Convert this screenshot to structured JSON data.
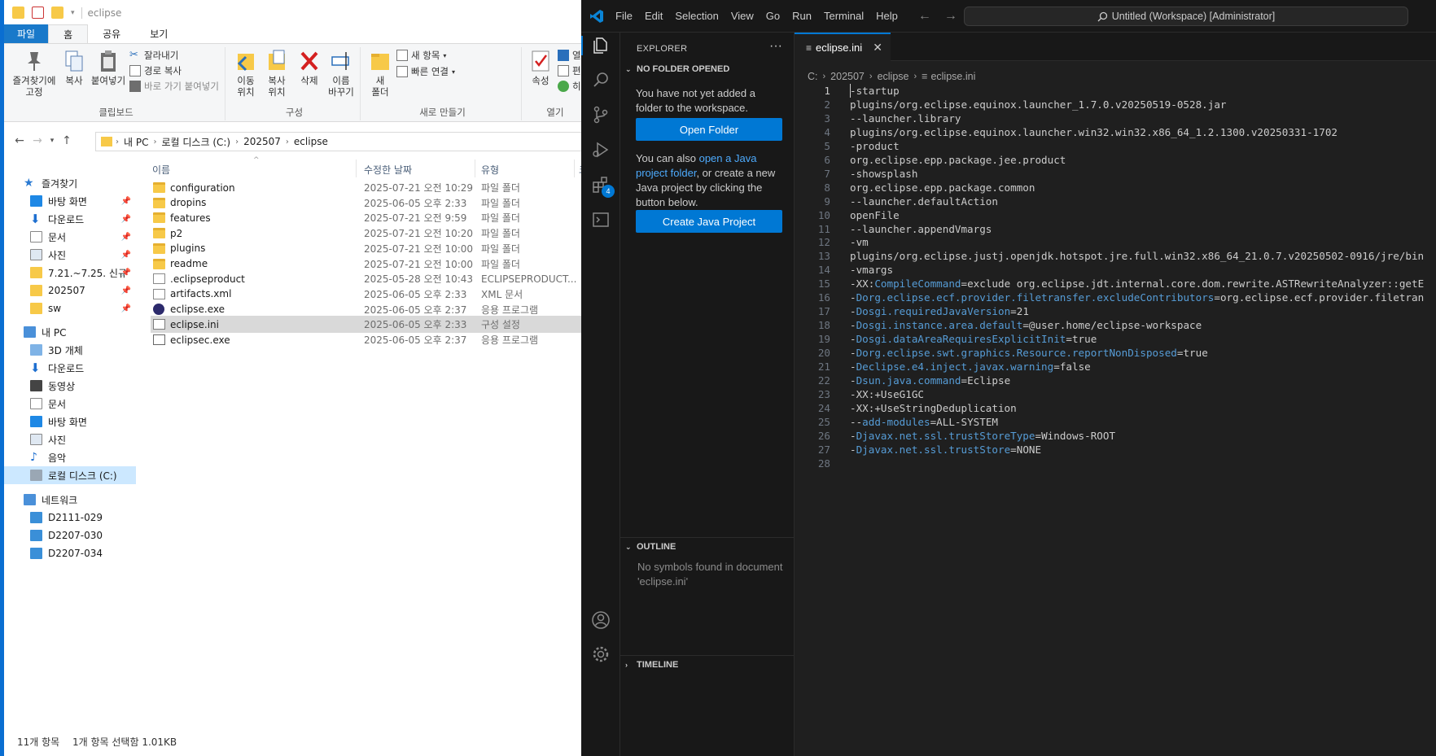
{
  "explorer": {
    "title": "eclipse",
    "tabs": [
      "파일",
      "홈",
      "공유",
      "보기"
    ],
    "ribbon": {
      "clipboard": {
        "pin": "즐겨찾기에\n고정",
        "copy": "복사",
        "paste": "붙여넣기",
        "cut": "잘라내기",
        "copy_path": "경로 복사",
        "paste_shortcut": "바로 가기 붙여넣기",
        "label": "클립보드"
      },
      "organize": {
        "move_to": "이동\n위치",
        "copy_to": "복사\n위치",
        "delete": "삭제",
        "rename": "이름\n바꾸기",
        "label": "구성"
      },
      "new": {
        "new_folder": "새\n폴더",
        "new_item": "새 항목",
        "easy_access": "빠른 연결",
        "label": "새로 만들기"
      },
      "open": {
        "properties": "속성",
        "open_short": "열",
        "edit_short": "편",
        "history_short": "히",
        "label": "열기"
      }
    },
    "address": [
      "내 PC",
      "로컬 디스크 (C:)",
      "202507",
      "eclipse"
    ],
    "nav": {
      "quick_access": "즐겨찾기",
      "quick_items": [
        "바탕 화면",
        "다운로드",
        "문서",
        "사진",
        "7.21.~7.25. 신규",
        "202507",
        "sw"
      ],
      "this_pc": "내 PC",
      "pc_items": [
        "3D 개체",
        "다운로드",
        "동영상",
        "문서",
        "바탕 화면",
        "사진",
        "음악",
        "로컬 디스크 (C:)"
      ],
      "network": "네트워크",
      "network_items": [
        "D2111-029",
        "D2207-030",
        "D2207-034"
      ]
    },
    "columns": [
      "이름",
      "수정한 날짜",
      "유형",
      "크"
    ],
    "files": [
      {
        "name": "configuration",
        "date": "2025-07-21 오전 10:29",
        "type": "파일 폴더",
        "icon": "folder"
      },
      {
        "name": "dropins",
        "date": "2025-06-05 오후 2:33",
        "type": "파일 폴더",
        "icon": "folder"
      },
      {
        "name": "features",
        "date": "2025-07-21 오전 9:59",
        "type": "파일 폴더",
        "icon": "folder"
      },
      {
        "name": "p2",
        "date": "2025-07-21 오전 10:20",
        "type": "파일 폴더",
        "icon": "folder"
      },
      {
        "name": "plugins",
        "date": "2025-07-21 오전 10:00",
        "type": "파일 폴더",
        "icon": "folder"
      },
      {
        "name": "readme",
        "date": "2025-07-21 오전 10:00",
        "type": "파일 폴더",
        "icon": "folder"
      },
      {
        "name": ".eclipseproduct",
        "date": "2025-05-28 오전 10:43",
        "type": "ECLIPSEPRODUCT...",
        "icon": "doc"
      },
      {
        "name": "artifacts.xml",
        "date": "2025-06-05 오후 2:33",
        "type": "XML 문서",
        "icon": "doc"
      },
      {
        "name": "eclipse.exe",
        "date": "2025-06-05 오후 2:37",
        "type": "응용 프로그램",
        "icon": "exe"
      },
      {
        "name": "eclipse.ini",
        "date": "2025-06-05 오후 2:33",
        "type": "구성 설정",
        "icon": "ini"
      },
      {
        "name": "eclipsec.exe",
        "date": "2025-06-05 오후 2:37",
        "type": "응용 프로그램",
        "icon": "exe2"
      }
    ],
    "status_count": "11개 항목",
    "status_selected": "1개 항목 선택함 1.01KB"
  },
  "vscode": {
    "menu": [
      "File",
      "Edit",
      "Selection",
      "View",
      "Go",
      "Run",
      "Terminal",
      "Help"
    ],
    "command_center": "Untitled (Workspace) [Administrator]",
    "explorer_title": "EXPLORER",
    "no_folder": "NO FOLDER OPENED",
    "no_folder_msg": "You have not yet added a folder to the workspace.",
    "open_folder_btn": "Open Folder",
    "java_msg_pre": "You can also ",
    "java_msg_link": "open a Java project folder",
    "java_msg_post": ", or create a new Java project by clicking the button below.",
    "create_java_btn": "Create Java Project",
    "outline": "OUTLINE",
    "outline_msg": "No symbols found in document 'eclipse.ini'",
    "timeline": "TIMELINE",
    "extensions_badge": "4",
    "tab_name": "eclipse.ini",
    "breadcrumb": [
      "C:",
      "202507",
      "eclipse",
      "eclipse.ini"
    ],
    "lines": [
      {
        "n": "1",
        "k": "",
        "v": "-startup"
      },
      {
        "n": "2",
        "k": "",
        "v": "plugins/org.eclipse.equinox.launcher_1.7.0.v20250519-0528.jar"
      },
      {
        "n": "3",
        "k": "",
        "v": "--launcher.library"
      },
      {
        "n": "4",
        "k": "",
        "v": "plugins/org.eclipse.equinox.launcher.win32.win32.x86_64_1.2.1300.v20250331-1702"
      },
      {
        "n": "5",
        "k": "",
        "v": "-product"
      },
      {
        "n": "6",
        "k": "",
        "v": "org.eclipse.epp.package.jee.product"
      },
      {
        "n": "7",
        "k": "",
        "v": "-showsplash"
      },
      {
        "n": "8",
        "k": "",
        "v": "org.eclipse.epp.package.common"
      },
      {
        "n": "9",
        "k": "",
        "v": "--launcher.defaultAction"
      },
      {
        "n": "10",
        "k": "",
        "v": "openFile"
      },
      {
        "n": "11",
        "k": "",
        "v": "--launcher.appendVmargs"
      },
      {
        "n": "12",
        "k": "",
        "v": "-vm"
      },
      {
        "n": "13",
        "k": "",
        "v": "plugins/org.eclipse.justj.openjdk.hotspot.jre.full.win32.x86_64_21.0.7.v20250502-0916/jre/bin"
      },
      {
        "n": "14",
        "k": "",
        "v": "-vmargs"
      },
      {
        "n": "15",
        "pre": "-XX:",
        "k": "CompileCommand",
        "v": "=exclude org.eclipse.jdt.internal.core.dom.rewrite.ASTRewriteAnalyzer::getE"
      },
      {
        "n": "16",
        "pre": "-",
        "k": "Dorg.eclipse.ecf.provider.filetransfer.excludeContributors",
        "v": "=org.eclipse.ecf.provider.filetran"
      },
      {
        "n": "17",
        "pre": "-",
        "k": "Dosgi.requiredJavaVersion",
        "v": "=21"
      },
      {
        "n": "18",
        "pre": "-",
        "k": "Dosgi.instance.area.default",
        "v": "=@user.home/eclipse-workspace"
      },
      {
        "n": "19",
        "pre": "-",
        "k": "Dosgi.dataAreaRequiresExplicitInit",
        "v": "=true"
      },
      {
        "n": "20",
        "pre": "-",
        "k": "Dorg.eclipse.swt.graphics.Resource.reportNonDisposed",
        "v": "=true"
      },
      {
        "n": "21",
        "pre": "-",
        "k": "Declipse.e4.inject.javax.warning",
        "v": "=false"
      },
      {
        "n": "22",
        "pre": "-",
        "k": "Dsun.java.command",
        "v": "=Eclipse"
      },
      {
        "n": "23",
        "k": "",
        "v": "-XX:+UseG1GC"
      },
      {
        "n": "24",
        "k": "",
        "v": "-XX:+UseStringDeduplication"
      },
      {
        "n": "25",
        "pre": "--",
        "k": "add-modules",
        "v": "=ALL-SYSTEM"
      },
      {
        "n": "26",
        "pre": "-",
        "k": "Djavax.net.ssl.trustStoreType",
        "v": "=Windows-ROOT"
      },
      {
        "n": "27",
        "pre": "-",
        "k": "Djavax.net.ssl.trustStore",
        "v": "=NONE"
      },
      {
        "n": "28",
        "k": "",
        "v": ""
      }
    ]
  },
  "colors": {
    "vscode_accent": "#0078d4",
    "code_key": "#569cd6",
    "explorer_file_tab": "#1979ca",
    "explorer_selection": "#cce8ff"
  }
}
